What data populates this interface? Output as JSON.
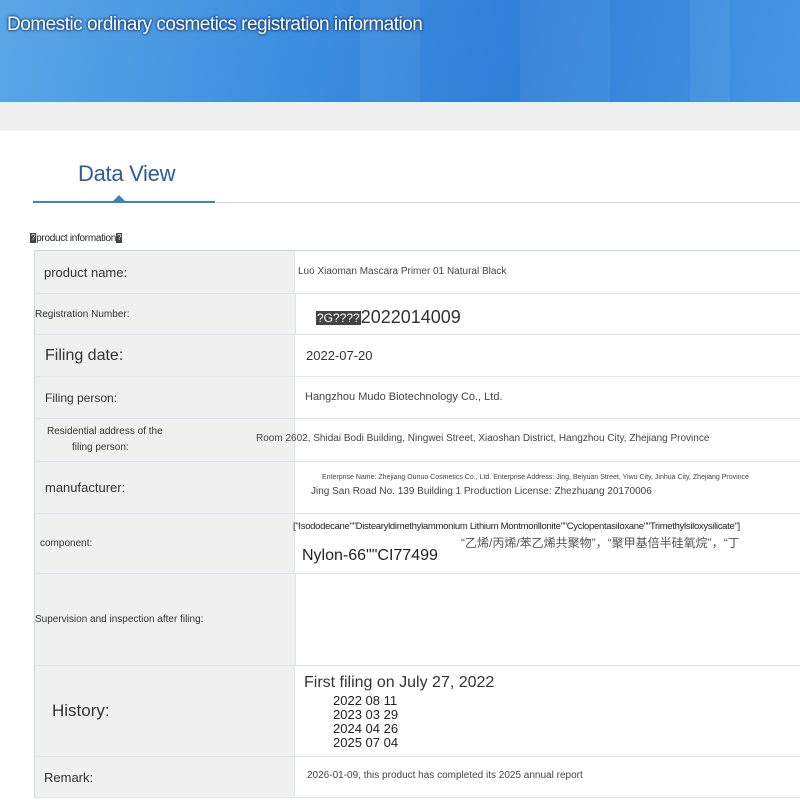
{
  "banner": {
    "title": "Domestic ordinary cosmetics registration information"
  },
  "tabs": [
    {
      "label": "Data View"
    }
  ],
  "section": {
    "label": "product information"
  },
  "fields": {
    "product_name": {
      "label": "product name:",
      "value": "Luo Xiaoman Mascara Primer 01 Natural Black"
    },
    "registration_number": {
      "label": "Registration Number:",
      "value": "2022014009"
    },
    "filing_date": {
      "label": "Filing date:",
      "value": "2022-07-20"
    },
    "filing_person": {
      "label": "Filing person:",
      "value": "Hangzhou Mudo Biotechnology Co., Ltd."
    },
    "residential_address": {
      "label_line1": "Residential address of the",
      "label_line2": "filing person:",
      "value": "Room 2602, Shidai Bodi Building, Ningwei Street, Xiaoshan District, Hangzhou City, Zhejiang Province"
    },
    "manufacturer": {
      "label": "manufacturer:",
      "value_line1": "Enterprise Name: Zhejiang Ounuo Cosmetics Co., Ltd. Enterprise Address: Jing, Beiyuan Street, Yiwu City, Jinhua City, Zhejiang Province",
      "value_line2": "Jing San Road No. 139 Building 1 Production License: Zhezhuang 20170006"
    },
    "component": {
      "label": "component:",
      "value_line1": "[\"Isododecane\"\"Distearyldimethylammonium Lithium Montmorillonite\"\"Cyclopentasiloxane\"\"Trimethylsiloxysilicate\"]",
      "value_line2": "“乙烯/丙烯/苯乙烯共聚物”，“聚甲基倍半硅氧烷”，“丁",
      "value_line3": "Nylon-66\"\"CI77499"
    },
    "supervision": {
      "label": "Supervision and inspection after filing:"
    },
    "history": {
      "label": "History:",
      "value_line1": "First filing on July 27, 2022",
      "entries": [
        "2022 08 11",
        "2023 03 29",
        "2024 04 26",
        "2025 07 04"
      ]
    },
    "remark": {
      "label": "Remark:",
      "value": "2026-01-09, this product has completed its 2025 annual report"
    }
  },
  "colors": {
    "accent": "#3b82c4",
    "tab_text": "#2c5d95",
    "label_bg": "#f0f0f0",
    "banner": "#2f7fd8"
  }
}
